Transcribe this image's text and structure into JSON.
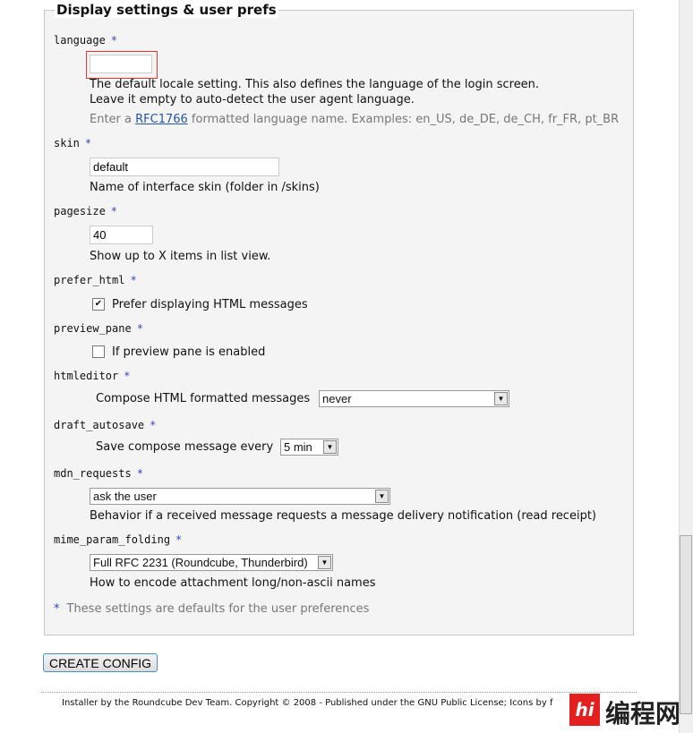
{
  "fieldset": {
    "legend": "Display settings & user prefs",
    "star": "*"
  },
  "language": {
    "label": "language",
    "value": "",
    "desc1": "The default locale setting. This also defines the language of the login screen.",
    "desc2": "Leave it empty to auto-detect the user agent language.",
    "hint_pre": "Enter a ",
    "hint_link": "RFC1766",
    "hint_post": " formatted language name. Examples: en_US, de_DE, de_CH, fr_FR, pt_BR"
  },
  "skin": {
    "label": "skin",
    "value": "default",
    "desc": "Name of interface skin (folder in /skins)"
  },
  "pagesize": {
    "label": "pagesize",
    "value": "40",
    "desc": "Show up to X items in list view."
  },
  "prefer_html": {
    "label": "prefer_html",
    "checked": true,
    "desc": "Prefer displaying HTML messages"
  },
  "preview_pane": {
    "label": "preview_pane",
    "checked": false,
    "desc": "If preview pane is enabled"
  },
  "htmleditor": {
    "label": "htmleditor",
    "desc": "Compose HTML formatted messages",
    "value": "never"
  },
  "draft_autosave": {
    "label": "draft_autosave",
    "desc": "Save compose message every",
    "value": "5 min"
  },
  "mdn_requests": {
    "label": "mdn_requests",
    "value": "ask the user",
    "desc": "Behavior if a received message requests a message delivery notification (read receipt)"
  },
  "mime_param_folding": {
    "label": "mime_param_folding",
    "value": "Full RFC 2231 (Roundcube, Thunderbird)",
    "desc": "How to encode attachment long/non-ascii names"
  },
  "note": "These settings are defaults for the user preferences",
  "create_button": "CREATE CONFIG",
  "footer": "Installer by the Roundcube Dev Team. Copyright © 2008 - Published under the GNU Public License;  Icons by f",
  "watermark": {
    "badge": "hi",
    "text": "编程网"
  }
}
